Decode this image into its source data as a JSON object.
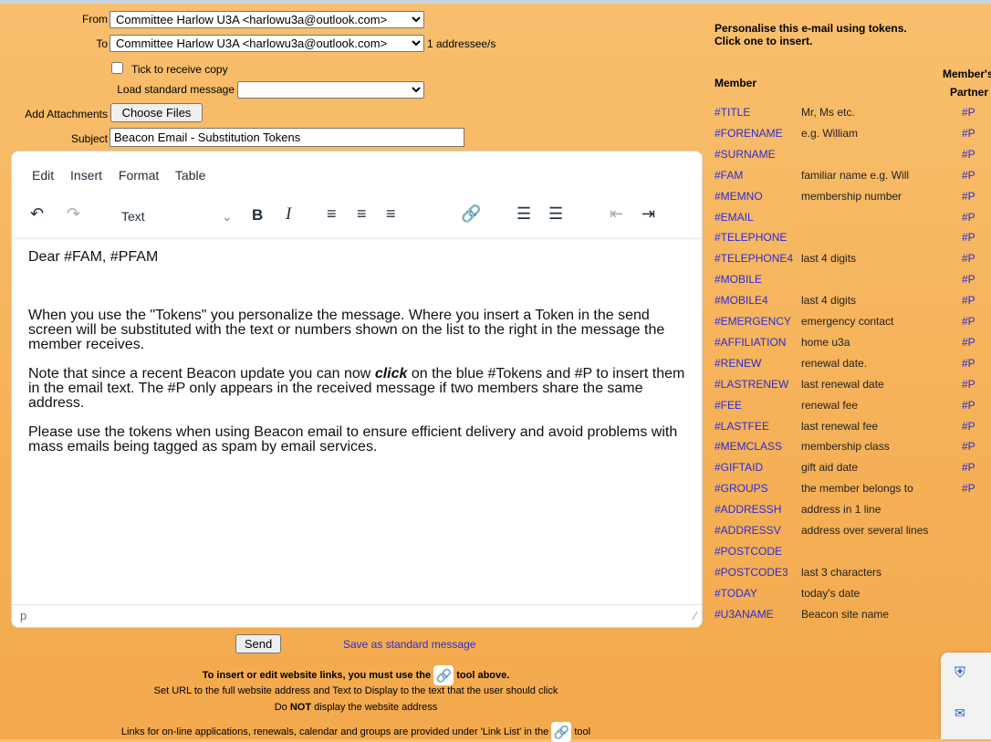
{
  "form": {
    "from_label": "From",
    "from_value": "Committee Harlow U3A <harlowu3a@outlook.com>",
    "to_label": "To",
    "to_value": "Committee Harlow U3A <harlowu3a@outlook.com>",
    "addressee_count": "1 addressee/s",
    "copy_label": "Tick to receive copy",
    "load_label": "Load standard message",
    "attach_label": "Add Attachments",
    "choose_files": "Choose Files",
    "subject_label": "Subject",
    "subject_value": "Beacon Email - Substitution Tokens"
  },
  "editor": {
    "menu": [
      "Edit",
      "Insert",
      "Format",
      "Table"
    ],
    "block_format": "Text",
    "body": [
      "Dear #FAM, #PFAM",
      "When you use the \"Tokens\" you personalize the message.  Where you insert a Token in the send screen will be substituted with the text or numbers shown on the list to the right in the message the member receives.",
      "Note that since a recent Beacon update you can now ",
      "click",
      " on the blue #Tokens  and #P to insert them in the email text.  The #P only appears in the received message if two members share the same address.",
      "Please use the tokens when using Beacon email to ensure efficient delivery and avoid problems with mass emails being tagged as spam by email services."
    ],
    "status_path": "p"
  },
  "actions": {
    "send": "Send",
    "save_standard": "Save as standard message"
  },
  "footer": {
    "line1a": "To insert or edit website links, you must use the",
    "line1b": "tool above.",
    "line2": "Set URL to the full website address and Text to Display to the text that the user should click",
    "line3a": "Do ",
    "line3b": "NOT",
    "line3c": " display the website address",
    "line4a": "Links for on-line applications, renewals, calendar and groups are provided under 'Link List' in the",
    "line4b": "tool"
  },
  "tokens": {
    "heading1": "Personalise this e-mail using tokens.",
    "heading2": "Click one to insert.",
    "col_member": "Member",
    "col_partner1": "Member's",
    "col_partner2": "Partner",
    "rows": [
      {
        "token": "#TITLE",
        "desc": "Mr, Ms etc.",
        "p": "#P"
      },
      {
        "token": "#FORENAME",
        "desc": "e.g. William",
        "p": "#P"
      },
      {
        "token": "#SURNAME",
        "desc": "",
        "p": "#P"
      },
      {
        "token": "#FAM",
        "desc": "familiar name e.g. Will",
        "p": "#P"
      },
      {
        "token": "#MEMNO",
        "desc": "membership number",
        "p": "#P"
      },
      {
        "token": "#EMAIL",
        "desc": "",
        "p": "#P"
      },
      {
        "token": "#TELEPHONE",
        "desc": "",
        "p": "#P"
      },
      {
        "token": "#TELEPHONE4",
        "desc": "last 4 digits",
        "p": "#P"
      },
      {
        "token": "#MOBILE",
        "desc": "",
        "p": "#P"
      },
      {
        "token": "#MOBILE4",
        "desc": "last 4 digits",
        "p": "#P"
      },
      {
        "token": "#EMERGENCY",
        "desc": "emergency contact",
        "p": "#P"
      },
      {
        "token": "#AFFILIATION",
        "desc": "home u3a",
        "p": "#P"
      },
      {
        "token": "#RENEW",
        "desc": "renewal date.",
        "p": "#P"
      },
      {
        "token": "#LASTRENEW",
        "desc": "last renewal date",
        "p": "#P"
      },
      {
        "token": "#FEE",
        "desc": "renewal fee",
        "p": "#P"
      },
      {
        "token": "#LASTFEE",
        "desc": "last renewal fee",
        "p": "#P"
      },
      {
        "token": "#MEMCLASS",
        "desc": "membership class",
        "p": "#P"
      },
      {
        "token": "#GIFTAID",
        "desc": "gift aid date",
        "p": "#P"
      },
      {
        "token": "#GROUPS",
        "desc": "the member belongs to",
        "p": "#P"
      },
      {
        "token": "#ADDRESSH",
        "desc": "address in 1 line",
        "p": ""
      },
      {
        "token": "#ADDRESSV",
        "desc": "address over several lines",
        "p": ""
      },
      {
        "token": "#POSTCODE",
        "desc": "",
        "p": ""
      },
      {
        "token": "#POSTCODE3",
        "desc": "last 3 characters",
        "p": ""
      },
      {
        "token": "#TODAY",
        "desc": "today's date",
        "p": ""
      },
      {
        "token": "#U3ANAME",
        "desc": "Beacon site name",
        "p": ""
      }
    ]
  },
  "colors": {
    "token_link": "#2b2bd8",
    "background": "#f6b45c"
  }
}
